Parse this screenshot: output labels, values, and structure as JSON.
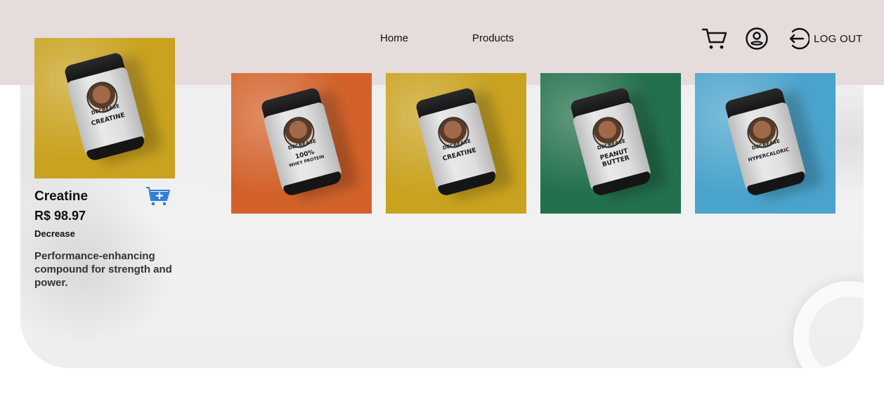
{
  "nav": {
    "home_label": "Home",
    "products_label": "Products",
    "logout_label": "LOG OUT"
  },
  "icons": {
    "cart": "cart-icon",
    "user": "user-circle-icon",
    "logout": "logout-icon",
    "add_to_cart": "add-to-cart-icon"
  },
  "featured": {
    "name": "Creatine",
    "price": "R$ 98.97",
    "brand": "Decrease",
    "description": "Performance-enhancing compound for strength and power.",
    "jar_brand": "DECREASE",
    "jar_label": "CREATINE",
    "bg_color": "#c9a21f"
  },
  "products": [
    {
      "jar_brand": "DECREASE",
      "jar_label": "100%",
      "jar_sub": "WHEY PROTEIN",
      "bg_color": "#d2622a"
    },
    {
      "jar_brand": "DECREASE",
      "jar_label": "CREATINE",
      "jar_sub": "",
      "bg_color": "#c9a21f"
    },
    {
      "jar_brand": "DECREASE",
      "jar_label": "PEANUT BUTTER",
      "jar_sub": "",
      "bg_color": "#23704c"
    },
    {
      "jar_brand": "DECREASE",
      "jar_label": "HYPERCALORIC",
      "jar_sub": "",
      "bg_color": "#4aa3cc"
    }
  ],
  "colors": {
    "header_bg": "#e5dcdb",
    "add_cart_blue": "#2f7fd6"
  }
}
